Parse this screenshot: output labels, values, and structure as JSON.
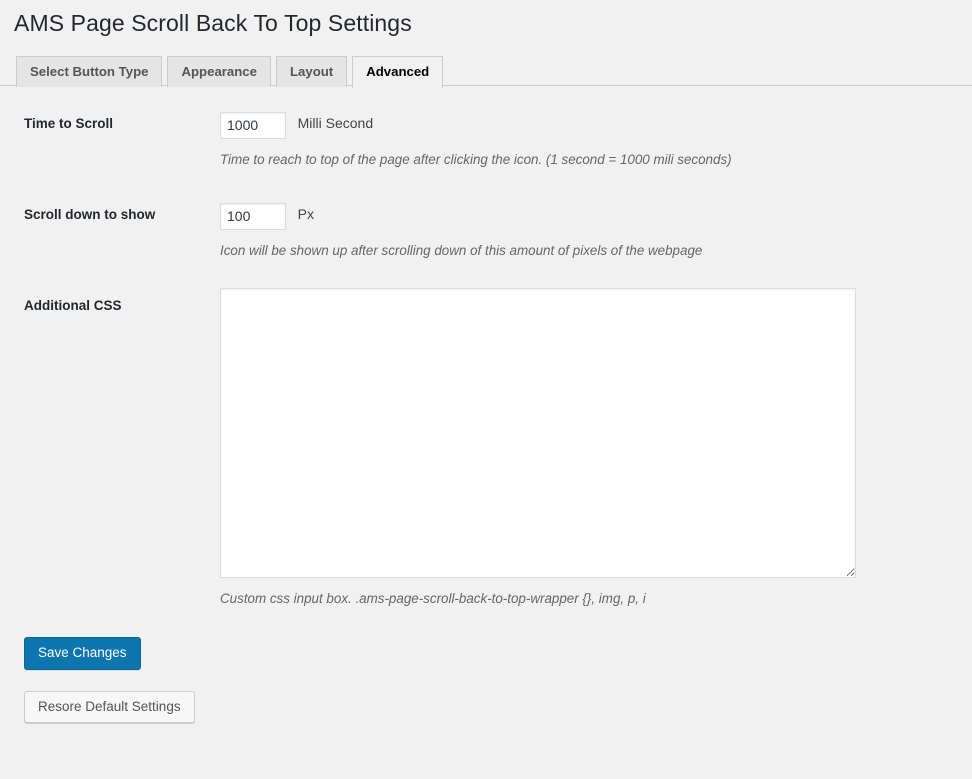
{
  "page": {
    "title": "AMS Page Scroll Back To Top Settings"
  },
  "tabs": [
    {
      "label": "Select Button Type",
      "active": false
    },
    {
      "label": "Appearance",
      "active": false
    },
    {
      "label": "Layout",
      "active": false
    },
    {
      "label": "Advanced",
      "active": true
    }
  ],
  "fields": {
    "time_to_scroll": {
      "label": "Time to Scroll",
      "value": "1000",
      "unit": "Milli Second",
      "description": "Time to reach to top of the page after clicking the icon. (1 second = 1000 mili seconds)"
    },
    "scroll_down_to_show": {
      "label": "Scroll down to show",
      "value": "100",
      "unit": "Px",
      "description": "Icon will be shown up after scrolling down of this amount of pixels of the webpage"
    },
    "additional_css": {
      "label": "Additional CSS",
      "value": "",
      "placeholder": "",
      "description": "Custom css input box. .ams-page-scroll-back-to-top-wrapper {}, img, p, i"
    }
  },
  "buttons": {
    "save": "Save Changes",
    "restore": "Resore Default Settings"
  },
  "colors": {
    "page_background": "#f1f1f1",
    "primary_button": "#0e76ae",
    "title_text": "#23282d",
    "tab_inactive_background": "#e5e5e5",
    "border": "#cccccc",
    "description_text": "#666666"
  }
}
